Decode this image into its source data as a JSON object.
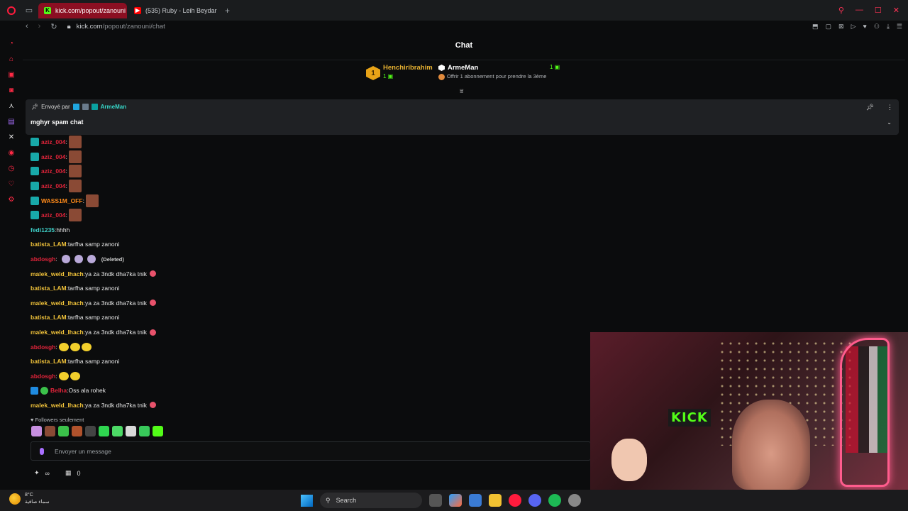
{
  "browser": {
    "tabs": [
      {
        "label": "kick.com/popout/zanouni",
        "active": true
      },
      {
        "label": "(535) Ruby - Leih Beydar",
        "active": false
      }
    ],
    "url_host": "kick.com",
    "url_path": "/popout/zanouni/chat"
  },
  "chat": {
    "title": "Chat",
    "top_gifters": {
      "first": {
        "rank": "1",
        "name": "Henchiribrahim",
        "count": "1"
      },
      "second": {
        "name": "ArmeMan",
        "count": "1",
        "offer": "Offrir 1 abonnement pour prendre la 3ème"
      }
    },
    "pinned": {
      "sent_by": "Envoyé par",
      "author": "ArmeMan",
      "message": "mghyr spam chat"
    },
    "messages": [
      {
        "user": "aziz_004",
        "color": "#e0243a",
        "text": "",
        "badge": "sub",
        "emotes": 1
      },
      {
        "user": "aziz_004",
        "color": "#e0243a",
        "text": "",
        "badge": "sub",
        "emotes": 1
      },
      {
        "user": "aziz_004",
        "color": "#e0243a",
        "text": "",
        "badge": "sub",
        "emotes": 1
      },
      {
        "user": "aziz_004",
        "color": "#e0243a",
        "text": "",
        "badge": "sub",
        "emotes": 1
      },
      {
        "user": "WASS1M_OFF",
        "color": "#ff8a1a",
        "text": "",
        "badge": "sub",
        "emotes": 1
      },
      {
        "user": "aziz_004",
        "color": "#e0243a",
        "text": "",
        "badge": "sub",
        "emotes": 1
      },
      {
        "user": "fedi1235",
        "color": "#3fd0c8",
        "text": "hhhh"
      },
      {
        "user": "batista_LAM",
        "color": "#f0c23a",
        "text": "tarfha samp zanoni"
      },
      {
        "user": "abdosgh",
        "color": "#e0243a",
        "text": "",
        "ghosts": 3,
        "deleted": "(Deleted)"
      },
      {
        "user": "malek_weld_lhach",
        "color": "#f0c23a",
        "text": "ya za 3ndk dha7ka tnik",
        "heart": true
      },
      {
        "user": "batista_LAM",
        "color": "#f0c23a",
        "text": "tarfha samp zanoni"
      },
      {
        "user": "malek_weld_lhach",
        "color": "#f0c23a",
        "text": "ya za 3ndk dha7ka tnik",
        "heart": true
      },
      {
        "user": "batista_LAM",
        "color": "#f0c23a",
        "text": "tarfha samp zanoni"
      },
      {
        "user": "malek_weld_lhach",
        "color": "#f0c23a",
        "text": "ya za 3ndk dha7ka tnik",
        "heart": true
      },
      {
        "user": "abdosgh",
        "color": "#e0243a",
        "text": "",
        "yellow": 3
      },
      {
        "user": "batista_LAM",
        "color": "#f0c23a",
        "text": "tarfha samp zanoni"
      },
      {
        "user": "abdosgh",
        "color": "#e0243a",
        "text": "",
        "yellow": 2
      },
      {
        "user": "Belha",
        "color": "#e0243a",
        "text": "Oss ala rohek",
        "badge": "bluegreen"
      },
      {
        "user": "malek_weld_lhach",
        "color": "#f0c23a",
        "text": "ya za 3ndk dha7ka tnik",
        "heart": true
      }
    ],
    "followers_only": "Followers seulement",
    "input_placeholder": "Envoyer un message",
    "bottom": {
      "count": "0"
    }
  },
  "webcam": {
    "sign": "KICK"
  },
  "taskbar": {
    "temp": "8°C",
    "weather_desc": "سماء صافية",
    "search": "Search"
  }
}
